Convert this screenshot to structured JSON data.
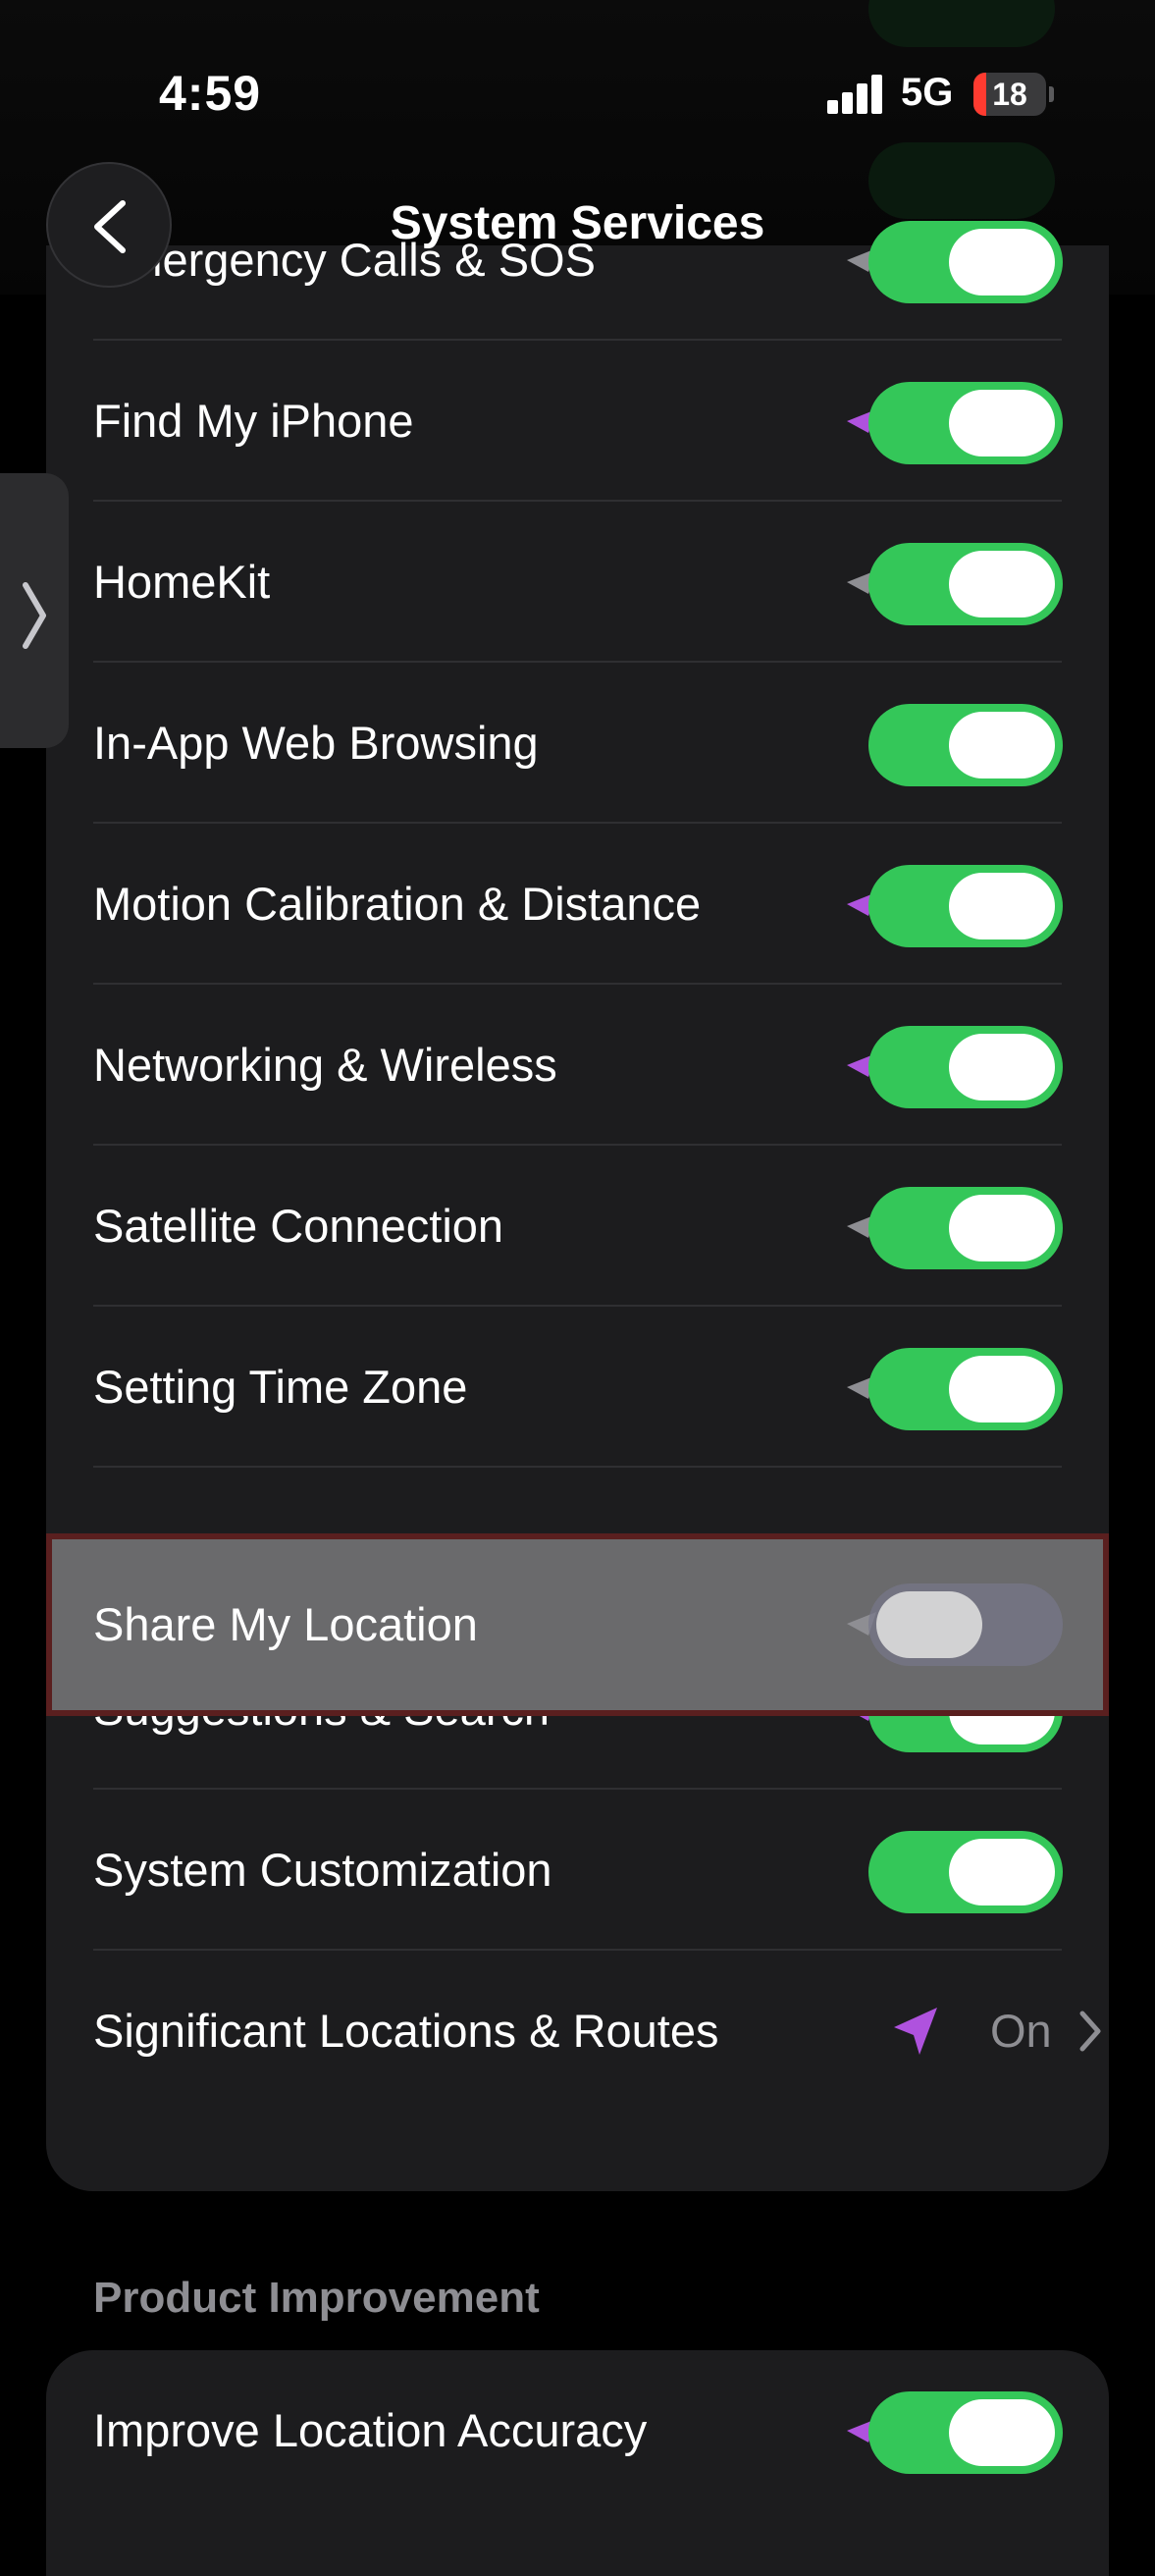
{
  "status_bar": {
    "time": "4:59",
    "network": "5G",
    "battery": "18",
    "battery_level": 0.18
  },
  "nav": {
    "title": "System Services",
    "back_icon": "chevron-left-icon"
  },
  "side_tab_icon": "chevron-right-icon",
  "colors": {
    "toggle_on": "#34c759",
    "location_arrow": "#af52de",
    "highlight_border": "#5a1f1f"
  },
  "rows": [
    {
      "label": "Emergency Calls & SOS",
      "toggle": "on",
      "arrow": "gray"
    },
    {
      "label": "Find My iPhone",
      "toggle": "on",
      "arrow": "purple"
    },
    {
      "label": "HomeKit",
      "toggle": "on",
      "arrow": "gray"
    },
    {
      "label": "In-App Web Browsing",
      "toggle": "on",
      "arrow": "none"
    },
    {
      "label": "Motion Calibration & Distance",
      "toggle": "on",
      "arrow": "purple"
    },
    {
      "label": "Networking & Wireless",
      "toggle": "on",
      "arrow": "purple"
    },
    {
      "label": "Satellite Connection",
      "toggle": "on",
      "arrow": "gray"
    },
    {
      "label": "Setting Time Zone",
      "toggle": "on",
      "arrow": "gray"
    },
    {
      "label": "Share My Location",
      "toggle": "off",
      "arrow": "gray",
      "highlighted": true
    },
    {
      "label": "Suggestions & Search",
      "toggle": "on",
      "arrow": "purple"
    },
    {
      "label": "System Customization",
      "toggle": "on",
      "arrow": "none"
    },
    {
      "label": "Significant Locations & Routes",
      "value": "On",
      "arrow": "purple"
    }
  ],
  "product_improvement": {
    "header": "Product Improvement",
    "rows": [
      {
        "label": "Improve Location Accuracy",
        "toggle": "on",
        "arrow": "purple"
      }
    ]
  }
}
